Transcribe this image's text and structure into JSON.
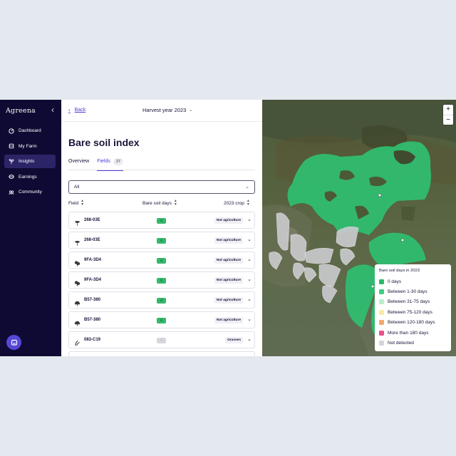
{
  "app": {
    "logo": "Agreena"
  },
  "sidebar": {
    "items": [
      {
        "label": "Dashboard",
        "icon": "dashboard-icon",
        "active": false
      },
      {
        "label": "My Farm",
        "icon": "farm-icon",
        "active": false
      },
      {
        "label": "Insights",
        "icon": "insights-icon",
        "active": true
      },
      {
        "label": "Earnings",
        "icon": "earnings-icon",
        "active": false
      },
      {
        "label": "Community",
        "icon": "community-icon",
        "active": false
      }
    ]
  },
  "header": {
    "back_label": "Back",
    "harvest_year": "Harvest year 2023"
  },
  "main": {
    "title": "Bare soil index",
    "tabs": [
      {
        "label": "Overview",
        "active": false
      },
      {
        "label": "Fields",
        "count": "27",
        "active": true
      }
    ],
    "filter_value": "All",
    "columns": {
      "field": "Field",
      "bare_soil": "Bare soil days",
      "crop": "2023 crop"
    },
    "rows": [
      {
        "name": "268-03E",
        "days": "0",
        "crop": "Not agriculture",
        "status": "green",
        "icon": "tree-icon"
      },
      {
        "name": "268-03E",
        "days": "0",
        "crop": "Not agriculture",
        "status": "green",
        "icon": "tree-icon"
      },
      {
        "name": "9FA-3D4",
        "days": "0",
        "crop": "Not agriculture",
        "status": "green",
        "icon": "shrub-icon"
      },
      {
        "name": "9FA-3D4",
        "days": "0",
        "crop": "Not agriculture",
        "status": "green",
        "icon": "shrub-icon"
      },
      {
        "name": "B57-380",
        "days": "0",
        "crop": "Not agriculture",
        "status": "green",
        "icon": "bush-icon"
      },
      {
        "name": "B57-380",
        "days": "0",
        "crop": "Not agriculture",
        "status": "green",
        "icon": "bush-icon"
      },
      {
        "name": "083-C19",
        "days": "-",
        "crop": "Grasses",
        "status": "gray",
        "icon": "grass-icon"
      }
    ]
  },
  "map": {
    "zoom_in": "+",
    "zoom_out": "−",
    "legend": {
      "title": "Bare soil days in 2023",
      "items": [
        {
          "label": "0 days",
          "color": "#2fb868"
        },
        {
          "label": "Between 1-30 days",
          "color": "#3ecf7f"
        },
        {
          "label": "Between 31-75 days",
          "color": "#b7efc7"
        },
        {
          "label": "Between 75-120 days",
          "color": "#fde8a3"
        },
        {
          "label": "Between 120-180 days",
          "color": "#f5a76c"
        },
        {
          "label": "More than 180 days",
          "color": "#e8528a"
        },
        {
          "label": "Not detected",
          "color": "#d3d3d8"
        }
      ]
    }
  },
  "colors": {
    "sidebar_bg": "#0f0a33",
    "accent": "#4b3fd1",
    "field_green": "#2fbf71",
    "field_gray": "#c9c9cc"
  }
}
